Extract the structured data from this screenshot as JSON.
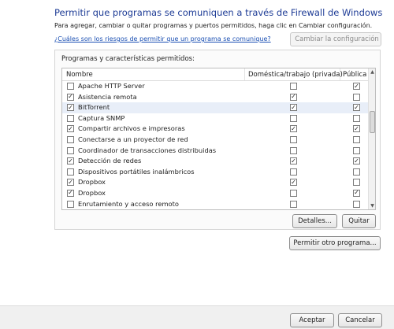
{
  "header": {
    "title": "Permitir que programas se comuniquen a través de Firewall de Windows",
    "subtitle": "Para agregar, cambiar o quitar programas y puertos permitidos, haga clic en Cambiar configuración.",
    "risk_link": "¿Cuáles son los riesgos de permitir que un programa se comunique?",
    "change_settings_label": "Cambiar la configuración"
  },
  "group": {
    "label": "Programas y características permitidos:",
    "columns": {
      "name": "Nombre",
      "domestic": "Doméstica/trabajo (privada)",
      "public": "Pública"
    },
    "rows": [
      {
        "name": "Apache HTTP Server",
        "enabled": false,
        "domestic": false,
        "public": true,
        "selected": false
      },
      {
        "name": "Asistencia remota",
        "enabled": true,
        "domestic": true,
        "public": false,
        "selected": false
      },
      {
        "name": "BitTorrent",
        "enabled": true,
        "domestic": true,
        "public": true,
        "selected": true
      },
      {
        "name": "Captura SNMP",
        "enabled": false,
        "domestic": false,
        "public": false,
        "selected": false
      },
      {
        "name": "Compartir archivos e impresoras",
        "enabled": true,
        "domestic": true,
        "public": true,
        "selected": false
      },
      {
        "name": "Conectarse a un proyector de red",
        "enabled": false,
        "domestic": false,
        "public": false,
        "selected": false
      },
      {
        "name": "Coordinador de transacciones distribuidas",
        "enabled": false,
        "domestic": false,
        "public": false,
        "selected": false
      },
      {
        "name": "Detección de redes",
        "enabled": true,
        "domestic": true,
        "public": true,
        "selected": false
      },
      {
        "name": "Dispositivos portátiles inalámbricos",
        "enabled": false,
        "domestic": false,
        "public": false,
        "selected": false
      },
      {
        "name": "Dropbox",
        "enabled": true,
        "domestic": true,
        "public": false,
        "selected": false
      },
      {
        "name": "Dropbox",
        "enabled": true,
        "domestic": false,
        "public": true,
        "selected": false
      },
      {
        "name": "Enrutamiento y acceso remoto",
        "enabled": false,
        "domestic": false,
        "public": false,
        "selected": false
      }
    ],
    "details_label": "Detalles...",
    "remove_label": "Quitar"
  },
  "allow_other_label": "Permitir otro programa...",
  "footer": {
    "accept_label": "Aceptar",
    "cancel_label": "Cancelar"
  },
  "check_glyph": "✓"
}
